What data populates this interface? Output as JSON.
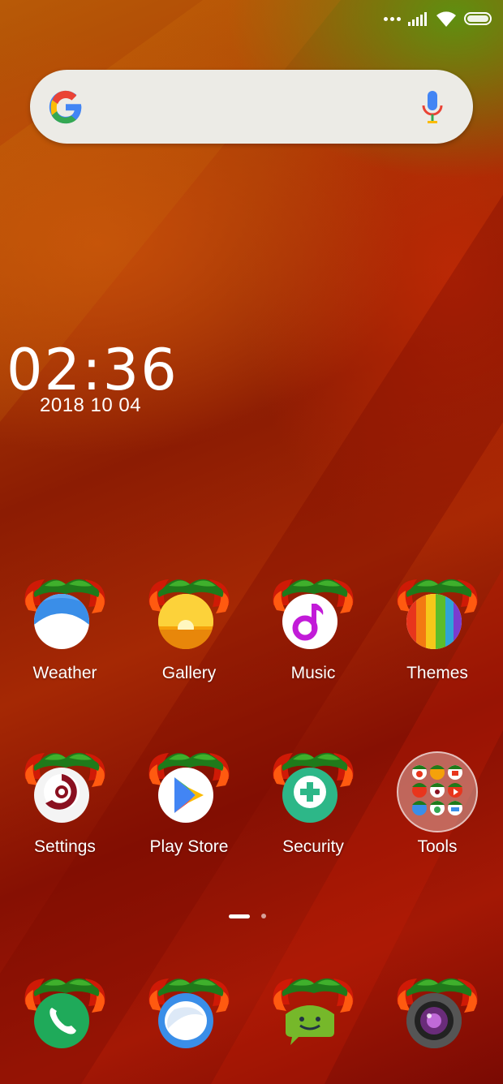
{
  "status_bar": {
    "signal_icon": "cell-signal-icon",
    "wifi_icon": "wifi-icon",
    "battery_icon": "battery-icon"
  },
  "search_widget": {
    "logo_icon": "google-g-icon",
    "voice_icon": "microphone-icon"
  },
  "clock": {
    "time": "02:36",
    "date": "2018 10 04"
  },
  "apps_row1": [
    {
      "label": "Weather",
      "icon": "weather-icon"
    },
    {
      "label": "Gallery",
      "icon": "gallery-icon"
    },
    {
      "label": "Music",
      "icon": "music-icon"
    },
    {
      "label": "Themes",
      "icon": "themes-icon"
    }
  ],
  "apps_row2": [
    {
      "label": "Settings",
      "icon": "settings-icon"
    },
    {
      "label": "Play Store",
      "icon": "play-store-icon"
    },
    {
      "label": "Security",
      "icon": "security-icon"
    },
    {
      "label": "Tools",
      "icon": "folder-icon"
    }
  ],
  "pager": {
    "pages": 2,
    "current": 1
  },
  "dock": [
    {
      "icon": "phone-icon"
    },
    {
      "icon": "messages-icon"
    },
    {
      "icon": "android-icon"
    },
    {
      "icon": "camera-icon"
    }
  ],
  "colors": {
    "wallpaper_primary": "#9b1c04",
    "wallpaper_accent": "#5f8f10",
    "label": "#ffffff"
  }
}
